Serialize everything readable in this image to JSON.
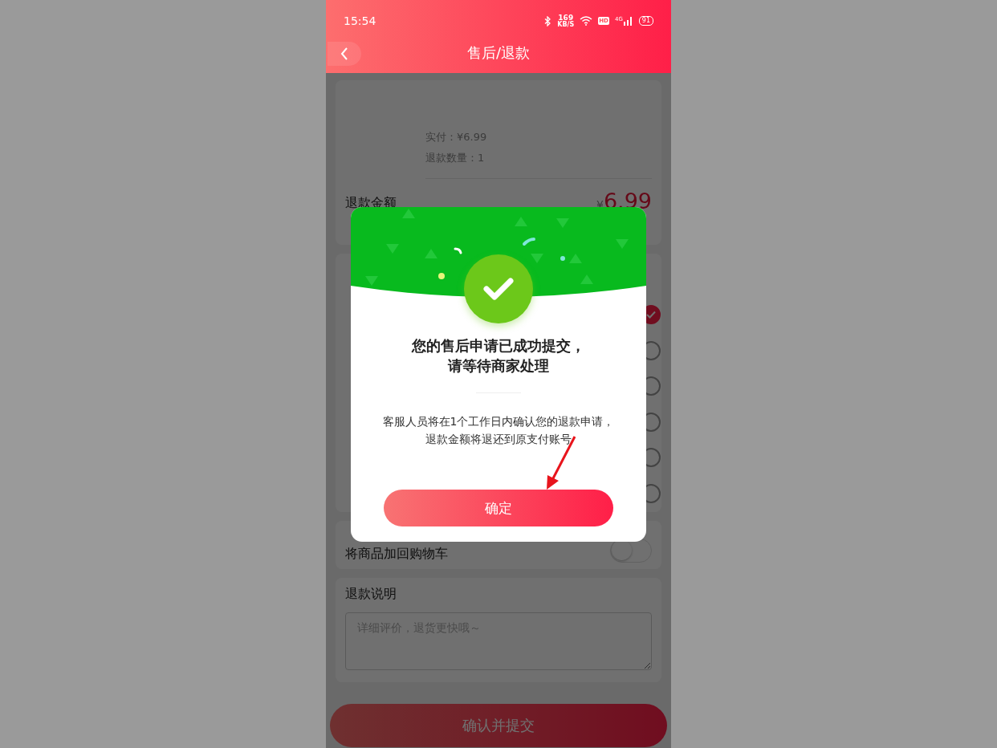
{
  "status_bar": {
    "time": "15:54",
    "net_speed": "169",
    "net_speed_unit": "KB/S",
    "hd_label": "HD",
    "network_type": "4G",
    "battery": "91"
  },
  "header": {
    "title": "售后/退款"
  },
  "order": {
    "paid": "实付：¥6.99",
    "quantity": "退款数量：1"
  },
  "refund_amount": {
    "label": "退款金额",
    "currency": "¥",
    "amount": "6.99"
  },
  "reasons": [
    {
      "selected": true
    },
    {
      "selected": false
    },
    {
      "selected": false
    },
    {
      "selected": false
    },
    {
      "selected": false
    },
    {
      "selected": false
    }
  ],
  "add_to_cart": {
    "label": "将商品加回购物车",
    "on": false
  },
  "note": {
    "title": "退款说明",
    "placeholder": "详细评价，退货更快哦～"
  },
  "submit_button": "确认并提交",
  "dialog": {
    "title_lines": [
      "您的售后申请已成功提交，",
      "请等待商家处理"
    ],
    "message": "客服人员将在1个工作日内确认您的退款申请，退款金额将退还到原支付账号",
    "button": "确定"
  }
}
